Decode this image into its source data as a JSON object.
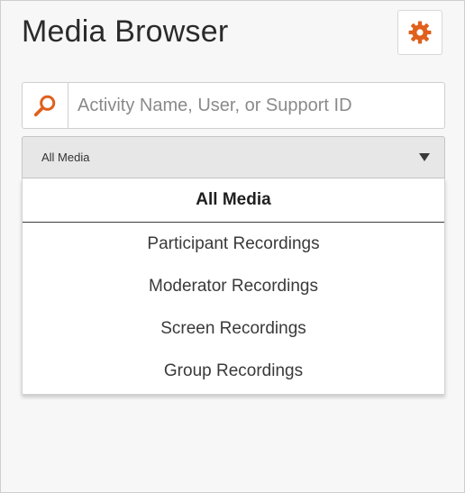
{
  "page": {
    "title": "Media Browser"
  },
  "settings": {
    "icon": "gear-icon",
    "color": "#e0601c"
  },
  "search": {
    "icon": "search-icon",
    "icon_color": "#e0601c",
    "placeholder": "Activity Name, User, or Support ID",
    "value": ""
  },
  "media_filter": {
    "selected": "All Media",
    "options": [
      {
        "label": "All Media"
      },
      {
        "label": "Participant Recordings"
      },
      {
        "label": "Moderator Recordings"
      },
      {
        "label": "Screen Recordings"
      },
      {
        "label": "Group Recordings"
      }
    ]
  }
}
